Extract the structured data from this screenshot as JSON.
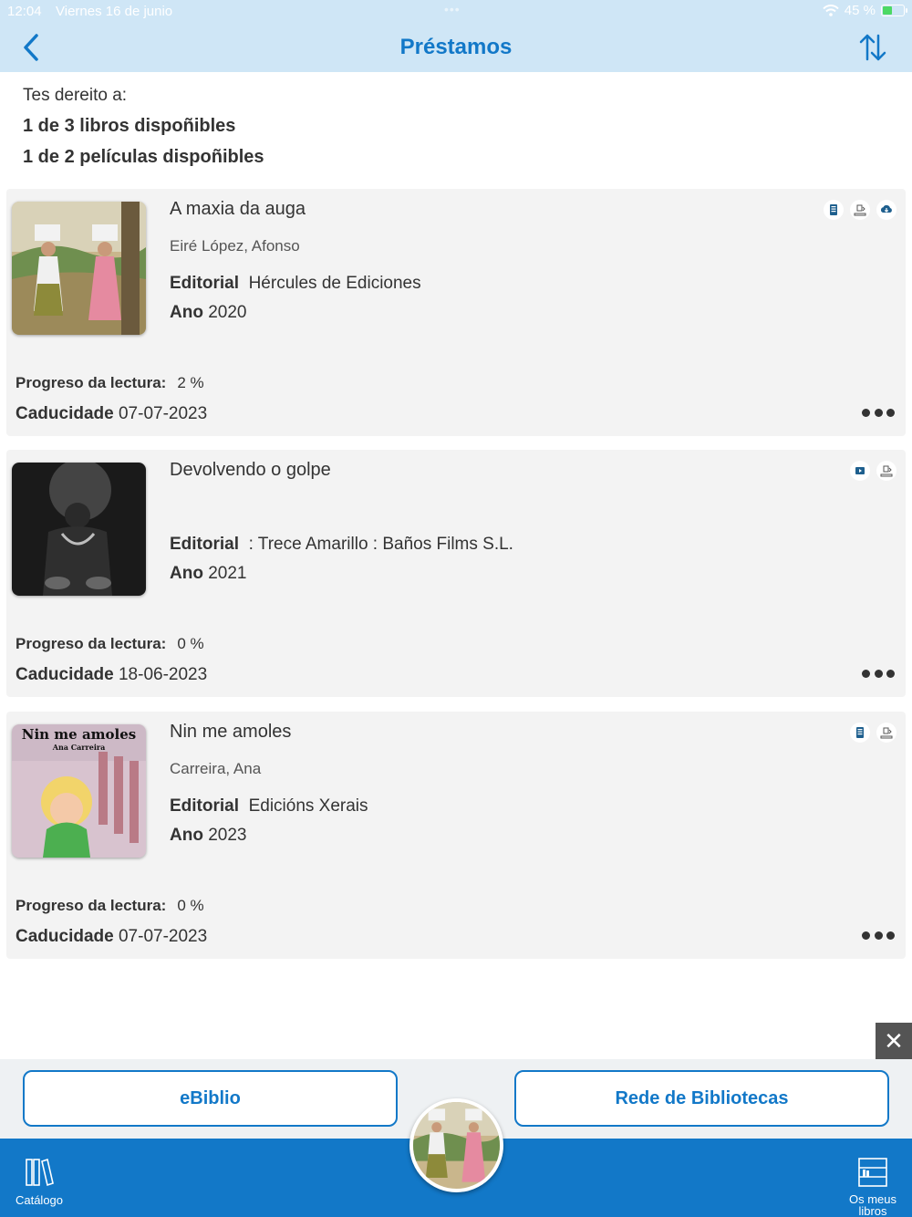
{
  "status_bar": {
    "time": "12:04",
    "date": "Viernes 16 de junio",
    "battery": "45 %"
  },
  "nav": {
    "title": "Préstamos",
    "back_icon": "chevron-left-icon",
    "sort_icon": "sort-arrows-icon"
  },
  "rights": {
    "intro": "Tes dereito a:",
    "books": "1 de 3 libros dispoñibles",
    "films": "1 de 2 películas dispoñibles"
  },
  "loans": [
    {
      "title": "A maxia da auga",
      "author": "Eiré López, Afonso",
      "editorial_label": "Editorial",
      "editorial": "Hércules de Ediciones",
      "year_label": "Ano",
      "year": "2020",
      "progress_label": "Progreso da lectura:",
      "progress": "2 %",
      "expiry_label": "Caducidade",
      "expiry": "07-07-2023",
      "icons": [
        "ebook-icon",
        "return-icon",
        "cloud-download-icon"
      ]
    },
    {
      "title": "Devolvendo o golpe",
      "author": "",
      "editorial_label": "Editorial",
      "editorial": ": Trece Amarillo  : Baños Films S.L.",
      "year_label": "Ano",
      "year": "2021",
      "progress_label": "Progreso da lectura:",
      "progress": "0 %",
      "expiry_label": "Caducidade",
      "expiry": "18-06-2023",
      "icons": [
        "video-icon",
        "return-icon"
      ]
    },
    {
      "title": "Nin me amoles",
      "author": "Carreira, Ana",
      "editorial_label": "Editorial",
      "editorial": "Edicións Xerais",
      "year_label": "Ano",
      "year": "2023",
      "progress_label": "Progreso da lectura:",
      "progress": "0 %",
      "expiry_label": "Caducidade",
      "expiry": "07-07-2023",
      "icons": [
        "ebook-icon",
        "return-icon"
      ],
      "cover_text_title": "Nin me amoles",
      "cover_text_author": "Ana Carreira"
    }
  ],
  "bottom": {
    "left_button": "eBiblio",
    "right_button": "Rede de Bibliotecas",
    "tab_catalog": "Catálogo",
    "tab_mybooks": "Os meus libros",
    "close_label": "✕"
  },
  "colors": {
    "accent": "#1278c8",
    "nav_bg": "#cfe6f6",
    "card_bg": "#f3f3f3"
  }
}
